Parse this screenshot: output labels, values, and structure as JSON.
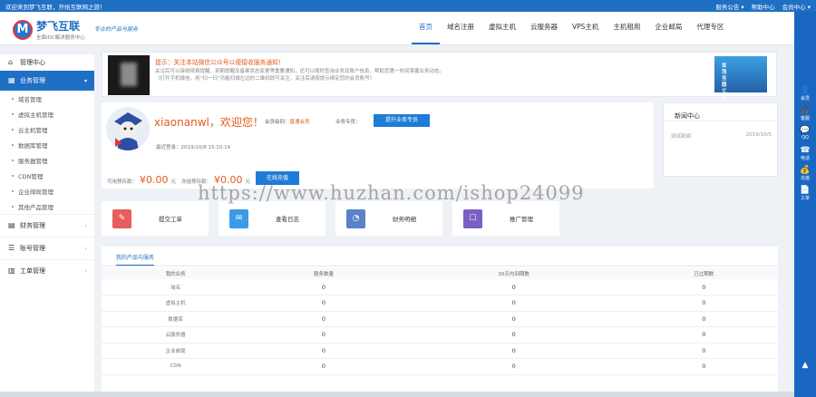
{
  "topbar": {
    "welcome": "欢迎来到梦飞互联，开始互联网之旅！",
    "links": [
      "服务公告 ▾",
      "帮助中心",
      "会员中心 ▾"
    ]
  },
  "brand": {
    "name": "梦飞互联",
    "tagline": "全面IDC解决服务中心",
    "slogan": "专业的产品与服务"
  },
  "nav": [
    "首页",
    "域名注册",
    "虚拟主机",
    "云服务器",
    "VPS主机",
    "主机租用",
    "企业邮局",
    "代理专区"
  ],
  "sidebar": {
    "top": "管理中心",
    "selected": "业务管理",
    "sub": [
      "域名管理",
      "虚拟主机管理",
      "云主机管理",
      "数据库管理",
      "服务器管理",
      "CDN管理",
      "企业邮局管理",
      "其他产品管理"
    ],
    "groups": [
      "财务管理",
      "账号管理",
      "工单管理"
    ]
  },
  "notice": {
    "title": "提示：关注本站微信公众号以便接收服务通知！",
    "lines": [
      "关注后可以接收续费提醒、到期提醒及备案状态变更等重要通知，还可以随时查询业务及账户信息，帮助您第一时间掌握业务动态。",
      "（打开手机微信，用“扫一扫”功能扫描左边的二维码即可关注，关注后请按提示绑定您的会员账号）"
    ],
    "banner": [
      "梦飞互联",
      "云服务器优惠"
    ]
  },
  "user": {
    "name": "xiaonanwl，欢迎您！",
    "level_label": "会员级别：",
    "level": "普通会员",
    "upgrade_label": "业务专员：",
    "upgrade_btn": "提升业务专员",
    "last_login": "最近登录：2019/10/8 15:10:14",
    "balance_label": "可用预存款：",
    "balance": "¥0.00",
    "balance_unit": "元",
    "frozen_label": "冻结预存款：",
    "frozen": "¥0.00",
    "frozen_unit": "元",
    "pay_btn": "在线充值"
  },
  "news": {
    "title": "新闻中心",
    "item": "测试新闻",
    "date": "2019/10/5"
  },
  "quick": [
    "提交工单",
    "查看日志",
    "财务明细",
    "推广管理"
  ],
  "watermark": "https://www.huzhan.com/ishop24099",
  "products": {
    "tab": "我的产品与服务",
    "headers": [
      "我的业务",
      "服务数量",
      "30天内到期数",
      "已过期数"
    ],
    "rows": [
      [
        "域名",
        "0",
        "0",
        "0"
      ],
      [
        "虚拟主机",
        "0",
        "0",
        "0"
      ],
      [
        "数据库",
        "0",
        "0",
        "0"
      ],
      [
        "云服务器",
        "0",
        "0",
        "0"
      ],
      [
        "企业邮局",
        "0",
        "0",
        "0"
      ],
      [
        "CDN",
        "0",
        "0",
        "0"
      ]
    ]
  },
  "rightbar": [
    [
      "👤",
      "会员"
    ],
    [
      "🎧",
      "客服"
    ],
    [
      "💬",
      "QQ"
    ],
    [
      "☎",
      "电话"
    ],
    [
      "💰",
      "充值"
    ],
    [
      "📄",
      "工单"
    ],
    [
      "▲",
      ""
    ]
  ],
  "colors": {
    "primary": "#1f6fc5",
    "accent": "#e45a1c"
  }
}
